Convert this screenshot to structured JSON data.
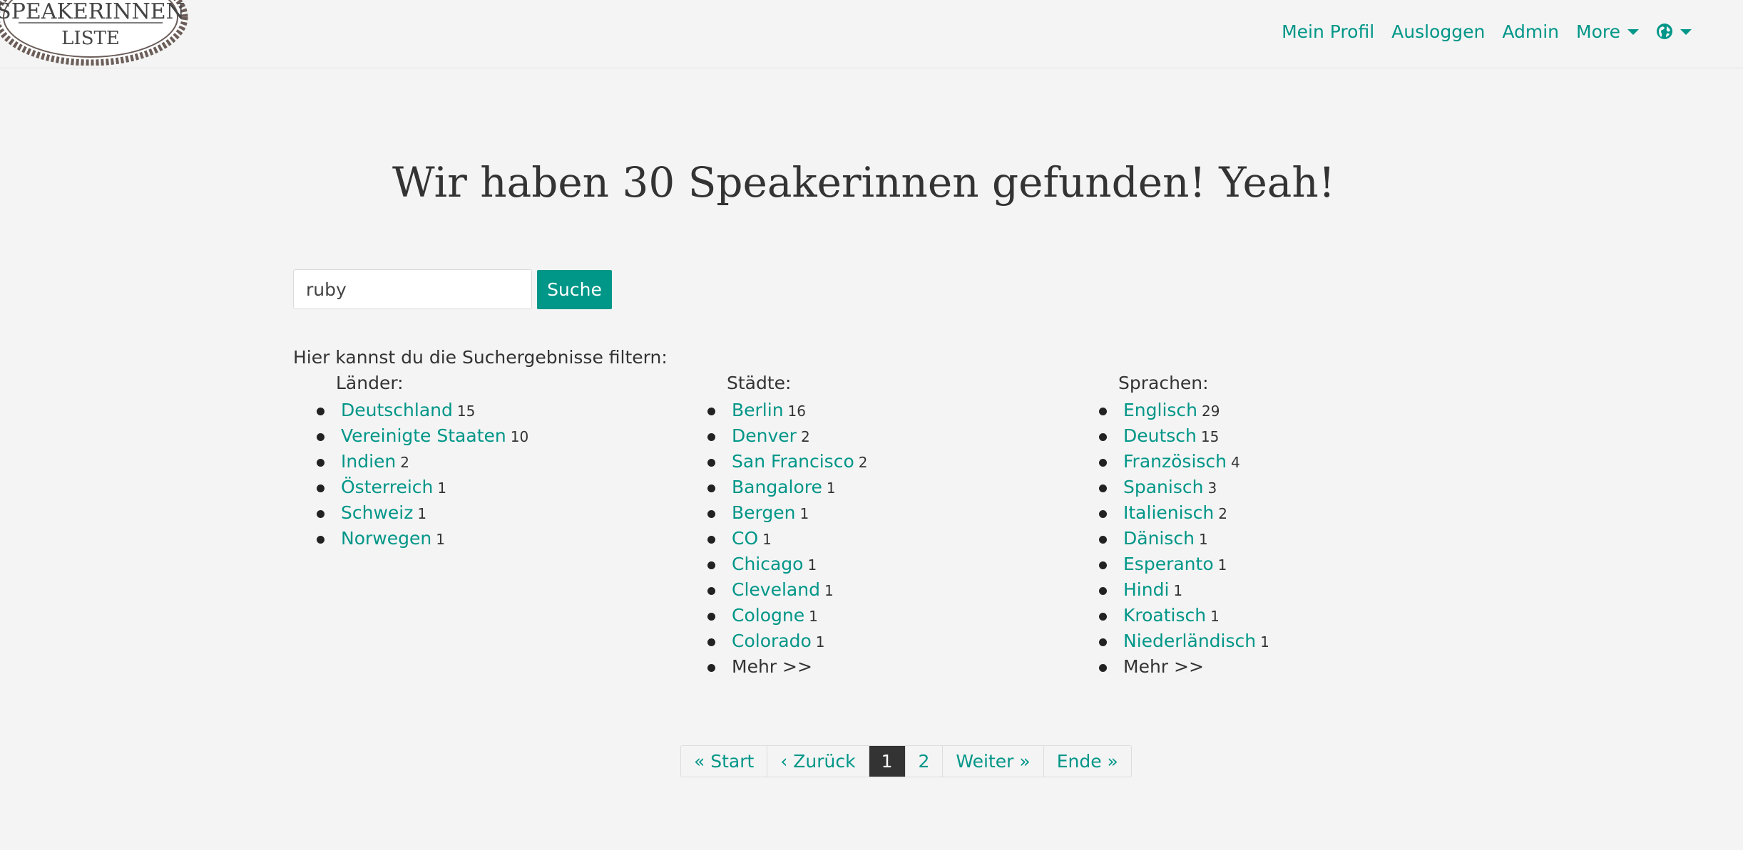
{
  "logo": {
    "line1": "SPEAKERINNEN",
    "line2": "LISTE"
  },
  "nav": {
    "profile": "Mein Profil",
    "logout": "Ausloggen",
    "admin": "Admin",
    "more": "More",
    "language_icon": "globe-icon"
  },
  "title": "Wir haben 30 Speakerinnen gefunden! Yeah!",
  "search": {
    "value": "ruby",
    "button": "Suche"
  },
  "filters": {
    "intro": "Hier kannst du die Suchergebnisse filtern:",
    "countries": {
      "heading": "Länder:",
      "items": [
        {
          "label": "Deutschland",
          "count": "15"
        },
        {
          "label": "Vereinigte Staaten",
          "count": "10"
        },
        {
          "label": "Indien",
          "count": "2"
        },
        {
          "label": "Österreich",
          "count": "1"
        },
        {
          "label": "Schweiz",
          "count": "1"
        },
        {
          "label": "Norwegen",
          "count": "1"
        }
      ]
    },
    "cities": {
      "heading": "Städte:",
      "items": [
        {
          "label": "Berlin",
          "count": "16"
        },
        {
          "label": "Denver",
          "count": "2"
        },
        {
          "label": "San Francisco",
          "count": "2"
        },
        {
          "label": "Bangalore",
          "count": "1"
        },
        {
          "label": "Bergen",
          "count": "1"
        },
        {
          "label": "CO",
          "count": "1"
        },
        {
          "label": "Chicago",
          "count": "1"
        },
        {
          "label": "Cleveland",
          "count": "1"
        },
        {
          "label": "Cologne",
          "count": "1"
        },
        {
          "label": "Colorado",
          "count": "1"
        }
      ],
      "more": "Mehr >>"
    },
    "languages": {
      "heading": "Sprachen:",
      "items": [
        {
          "label": "Englisch",
          "count": "29"
        },
        {
          "label": "Deutsch",
          "count": "15"
        },
        {
          "label": "Französisch",
          "count": "4"
        },
        {
          "label": "Spanisch",
          "count": "3"
        },
        {
          "label": "Italienisch",
          "count": "2"
        },
        {
          "label": "Dänisch",
          "count": "1"
        },
        {
          "label": "Esperanto",
          "count": "1"
        },
        {
          "label": "Hindi",
          "count": "1"
        },
        {
          "label": "Kroatisch",
          "count": "1"
        },
        {
          "label": "Niederländisch",
          "count": "1"
        }
      ],
      "more": "Mehr >>"
    }
  },
  "pagination": {
    "start": "« Start",
    "prev": "‹ Zurück",
    "pages": [
      "1",
      "2"
    ],
    "current": "1",
    "next": "Weiter »",
    "end": "Ende »"
  },
  "colors": {
    "accent": "#009688",
    "background": "#f4f4f4",
    "text": "#333333",
    "active_page": "#333333"
  }
}
